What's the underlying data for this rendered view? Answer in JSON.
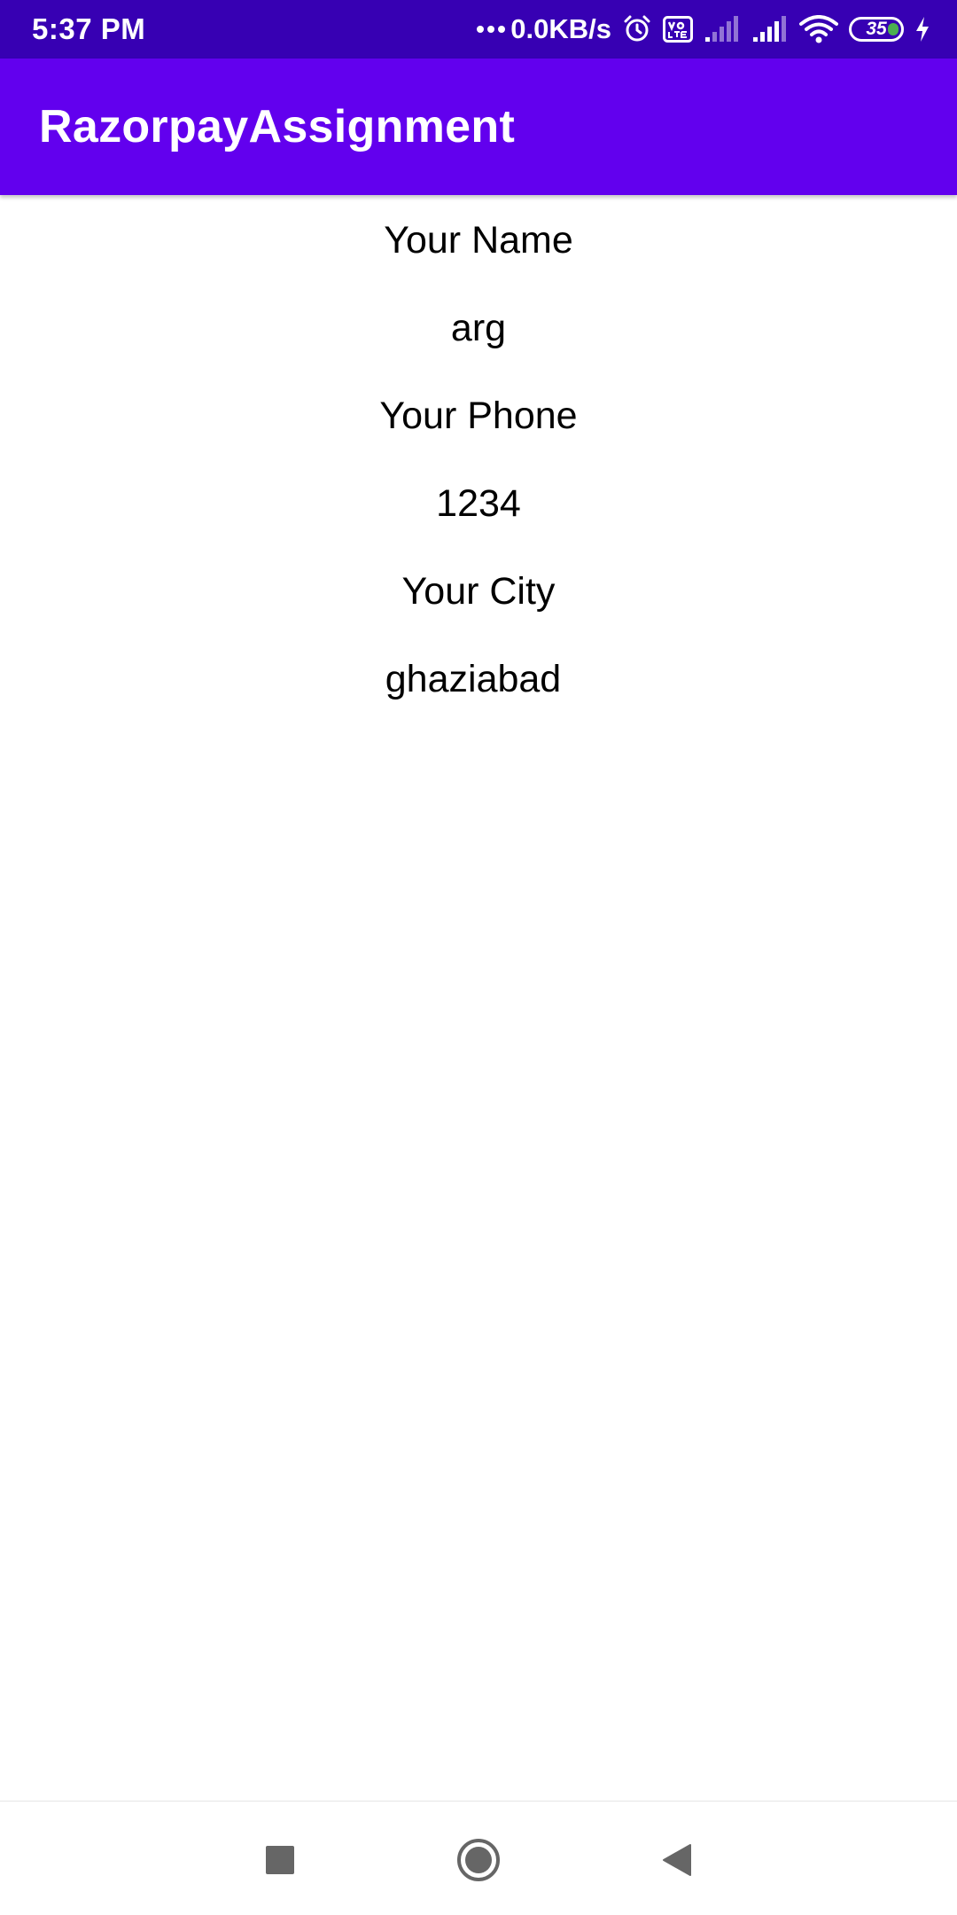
{
  "status_bar": {
    "time": "5:37 PM",
    "net_speed": "0.0KB/s",
    "battery_level": "35",
    "icons": [
      "alarm-icon",
      "volte-icon",
      "signal-weak-icon",
      "signal-icon",
      "wifi-icon",
      "battery-icon",
      "charging-icon"
    ],
    "background": "#3700b3"
  },
  "app_bar": {
    "title": "RazorpayAssignment",
    "background": "#6200ee"
  },
  "content": {
    "name_label": "Your Name",
    "name_value": "arg",
    "phone_label": "Your Phone",
    "phone_value": "1234",
    "city_label": "Your City",
    "city_value": "ghaziabad"
  },
  "nav_bar": {
    "icons": [
      "recents-icon",
      "home-icon",
      "back-icon"
    ]
  }
}
